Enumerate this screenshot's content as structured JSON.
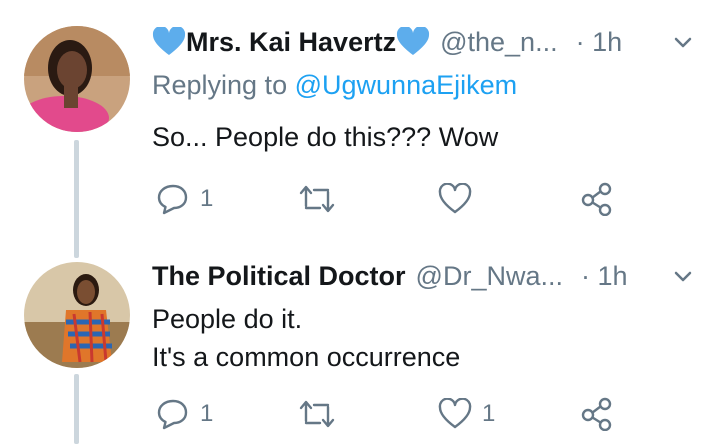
{
  "tweets": [
    {
      "name": "Mrs. Kai Havertz",
      "handle": "@the_n...",
      "time": "· 1h",
      "replying_prefix": "Replying to",
      "replying_to": "@UgwunnaEjikem",
      "text_lines": [
        "So... People do this??? Wow"
      ],
      "reply_count": "1",
      "retweet_count": "",
      "like_count": "",
      "name_emoji": "blue-heart-icon"
    },
    {
      "name": "The Political Doctor",
      "handle": "@Dr_Nwa...",
      "time": "· 1h",
      "text_lines": [
        "People do it.",
        "It's a common occurrence"
      ],
      "reply_count": "1",
      "retweet_count": "",
      "like_count": "1"
    }
  ],
  "colors": {
    "text": "#14171a",
    "secondary": "#657786",
    "link": "#1da1f2",
    "thread_line": "#ccd6dd"
  }
}
